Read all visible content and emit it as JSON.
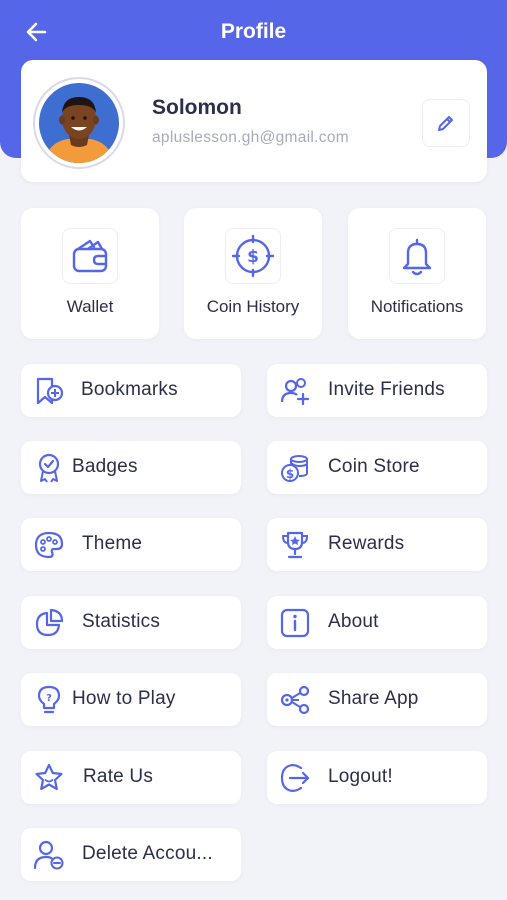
{
  "header": {
    "title": "Profile",
    "back_icon": "arrow-left-icon",
    "color": "#5566E8"
  },
  "profile": {
    "name": "Solomon",
    "email": "apluslesson.gh@gmail.com",
    "edit_icon": "pencil-icon"
  },
  "tiles": [
    {
      "label": "Wallet",
      "icon": "wallet-icon"
    },
    {
      "label": "Coin History",
      "icon": "dollar-coin-icon"
    },
    {
      "label": "Notifications",
      "icon": "bell-icon"
    }
  ],
  "menu": [
    {
      "label": "Bookmarks",
      "icon": "bookmark-add-icon"
    },
    {
      "label": "Invite Friends",
      "icon": "invite-user-icon"
    },
    {
      "label": "Badges",
      "icon": "badge-icon"
    },
    {
      "label": "Coin Store",
      "icon": "coin-stack-icon"
    },
    {
      "label": "Theme",
      "icon": "palette-icon"
    },
    {
      "label": "Rewards",
      "icon": "trophy-icon"
    },
    {
      "label": "Statistics",
      "icon": "pie-chart-icon"
    },
    {
      "label": "About",
      "icon": "info-icon"
    },
    {
      "label": "How to Play",
      "icon": "lightbulb-icon"
    },
    {
      "label": "Share App",
      "icon": "share-icon"
    },
    {
      "label": "Rate Us",
      "icon": "star-icon"
    },
    {
      "label": "Logout!",
      "icon": "logout-icon"
    },
    {
      "label": "Delete Accou...",
      "icon": "delete-user-icon"
    }
  ],
  "colors": {
    "accent": "#5566E8",
    "background": "#F2F3F9",
    "card": "#FFFFFF",
    "text": "#2B2F4A",
    "muted": "#A7AABD"
  }
}
